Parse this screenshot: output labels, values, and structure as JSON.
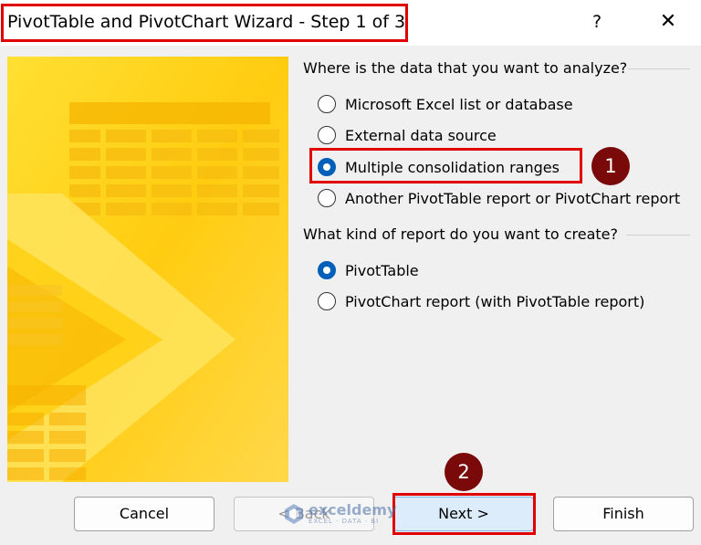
{
  "window": {
    "title": "PivotTable and PivotChart Wizard - Step 1 of 3",
    "help_glyph": "?",
    "close_glyph": "✕"
  },
  "source_section": {
    "label": "Where is the data that you want to analyze?",
    "options": [
      {
        "label": "Microsoft Excel list or database",
        "checked": false
      },
      {
        "label": "External data source",
        "checked": false
      },
      {
        "label": "Multiple consolidation ranges",
        "checked": true
      },
      {
        "label": "Another PivotTable report or PivotChart report",
        "checked": false
      }
    ]
  },
  "report_section": {
    "label": "What kind of report do you want to create?",
    "options": [
      {
        "label": "PivotTable",
        "checked": true
      },
      {
        "label": "PivotChart report (with PivotTable report)",
        "checked": false
      }
    ]
  },
  "annotations": {
    "step1": "1",
    "step2": "2"
  },
  "buttons": {
    "cancel": "Cancel",
    "back": "< Back",
    "next": "Next >",
    "finish": "Finish"
  },
  "watermark": {
    "name": "exceldemy",
    "sub": "EXCEL · DATA · BI"
  },
  "colors": {
    "highlight": "#e00000",
    "badge": "#7a0a0a",
    "radio_selected": "#005fb8",
    "art_yellow": "#ffd21a"
  }
}
